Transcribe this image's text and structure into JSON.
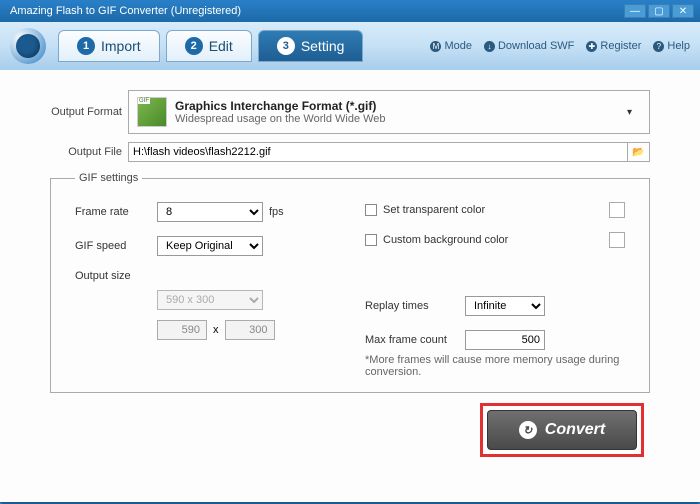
{
  "window": {
    "title": "Amazing Flash to GIF Converter (Unregistered)"
  },
  "tabs": [
    {
      "num": "1",
      "label": "Import"
    },
    {
      "num": "2",
      "label": "Edit"
    },
    {
      "num": "3",
      "label": "Setting"
    }
  ],
  "menu": {
    "mode": "Mode",
    "download_swf": "Download SWF",
    "register": "Register",
    "help": "Help"
  },
  "format": {
    "label": "Output Format",
    "title": "Graphics Interchange Format (*.gif)",
    "desc": "Widespread usage on the World Wide Web"
  },
  "file": {
    "label": "Output File",
    "value": "H:\\flash videos\\flash2212.gif"
  },
  "gif": {
    "legend": "GIF settings",
    "frame_rate_label": "Frame rate",
    "frame_rate_value": "8",
    "fps_unit": "fps",
    "gif_speed_label": "GIF speed",
    "gif_speed_value": "Keep Original",
    "output_size_label": "Output size",
    "output_size_value": "590 x 300",
    "width": "590",
    "height": "300",
    "transparent_label": "Set transparent color",
    "custom_bg_label": "Custom background color",
    "replay_label": "Replay times",
    "replay_value": "Infinite",
    "max_frame_label": "Max frame count",
    "max_frame_value": "500",
    "note": "*More frames will cause more memory usage during conversion."
  },
  "convert": {
    "label": "Convert"
  }
}
